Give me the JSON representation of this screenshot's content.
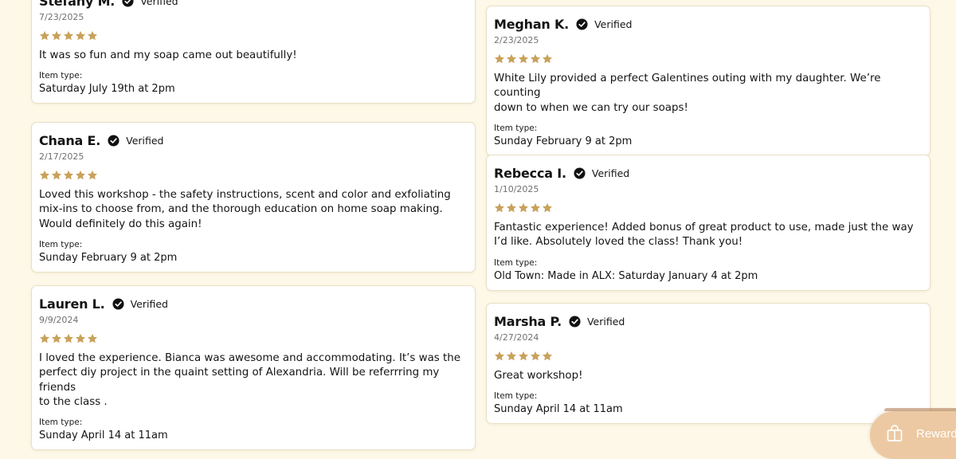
{
  "verified_label": "Verified",
  "item_type_label": "Item type:",
  "star_color": "#c9a15b",
  "left_reviews": [
    {
      "name": "Stefany M.",
      "date": "7/23/2025",
      "rating": 5,
      "text": "It was so fun and my soap came out beautifully!",
      "item_type": "Saturday July 19th at 2pm"
    },
    {
      "name": "Chana E.",
      "date": "2/17/2025",
      "rating": 5,
      "text": "Loved this workshop - the safety instructions, scent and color and exfoliating\nmix-ins to choose from, and the thorough education on home soap making.\nWould definitely do this again!",
      "item_type": "Sunday February 9 at 2pm"
    },
    {
      "name": "Lauren L.",
      "date": "9/9/2024",
      "rating": 5,
      "text": "I loved the experience. Bianca was awesome  and accommodating. It’s was the\nperfect diy project in the quaint setting of Alexandria. Will be referrring my friends\nto the class .",
      "item_type": "Sunday April 14 at 11am"
    }
  ],
  "right_reviews": [
    {
      "name": "Meghan K.",
      "date": "2/23/2025",
      "rating": 5,
      "text": "White Lily provided a perfect Galentines outing with my daughter. We’re counting\ndown to when we can try our soaps!",
      "item_type": "Sunday February 9 at 2pm"
    },
    {
      "name": "Rebecca I.",
      "date": "1/10/2025",
      "rating": 5,
      "text": "Fantastic experience! Added bonus of great product to use, made just the way\nI’d like. Absolutely loved the class! Thank you!",
      "item_type": "Old Town: Made in ALX: Saturday January 4 at 2pm"
    },
    {
      "name": "Marsha P.",
      "date": "4/27/2024",
      "rating": 5,
      "text": "Great workshop!",
      "item_type": "Sunday April 14 at 11am"
    }
  ],
  "rewards": {
    "label": "Reward",
    "icon": "gift-bag-icon",
    "color": "#ecc9a2"
  }
}
